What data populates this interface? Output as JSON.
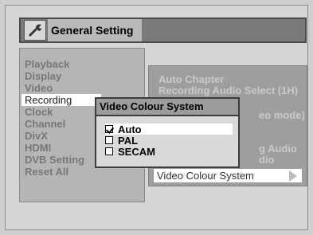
{
  "header": {
    "title": "General Setting",
    "icon": "wrench-icon"
  },
  "main_menu": {
    "items": [
      {
        "label": "Playback"
      },
      {
        "label": "Display"
      },
      {
        "label": "Video"
      },
      {
        "label": "Recording"
      },
      {
        "label": "Clock"
      },
      {
        "label": "Channel"
      },
      {
        "label": "DivX"
      },
      {
        "label": "HDMI"
      },
      {
        "label": "DVB Setting"
      },
      {
        "label": "Reset All"
      }
    ],
    "selected": "Recording"
  },
  "sub_menu": {
    "items": [
      {
        "label": "Auto Chapter"
      },
      {
        "label": "Recording Audio Select (1H)"
      },
      {
        "label": "eo mode)"
      },
      {
        "label": "g Audio"
      },
      {
        "label": "dio"
      },
      {
        "label": "Video Colour System"
      }
    ],
    "selected": "Video Colour System"
  },
  "popup": {
    "title": "Video Colour System",
    "options": [
      {
        "label": "Auto",
        "checked": true
      },
      {
        "label": "PAL",
        "checked": false
      },
      {
        "label": "SECAM",
        "checked": false
      }
    ]
  }
}
